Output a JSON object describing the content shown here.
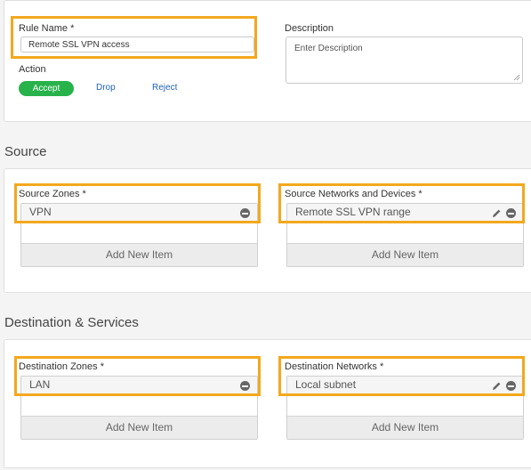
{
  "rule": {
    "name_label": "Rule Name",
    "required_mark": "*",
    "name_value": "Remote SSL VPN access",
    "description_label": "Description",
    "description_placeholder": "Enter Description",
    "action_label": "Action",
    "actions": [
      "Accept",
      "Drop",
      "Reject"
    ],
    "selected_action": "Accept"
  },
  "source": {
    "title": "Source",
    "zones_label": "Source Zones",
    "zones_required": "*",
    "zones_items": [
      "VPN"
    ],
    "zones_add_label": "Add New Item",
    "networks_label": "Source Networks and Devices",
    "networks_required": "*",
    "networks_items": [
      "Remote SSL VPN range"
    ],
    "networks_add_label": "Add New Item"
  },
  "destination": {
    "title": "Destination & Services",
    "zones_label": "Destination Zones",
    "zones_required": "*",
    "zones_items": [
      "LAN"
    ],
    "zones_add_label": "Add New Item",
    "networks_label": "Destination Networks",
    "networks_required": "*",
    "networks_items": [
      "Local subnet"
    ],
    "networks_add_label": "Add New Item"
  },
  "colors": {
    "highlight": "#f3a81e",
    "accept_green": "#27b24a",
    "link_blue": "#1f63b8"
  }
}
